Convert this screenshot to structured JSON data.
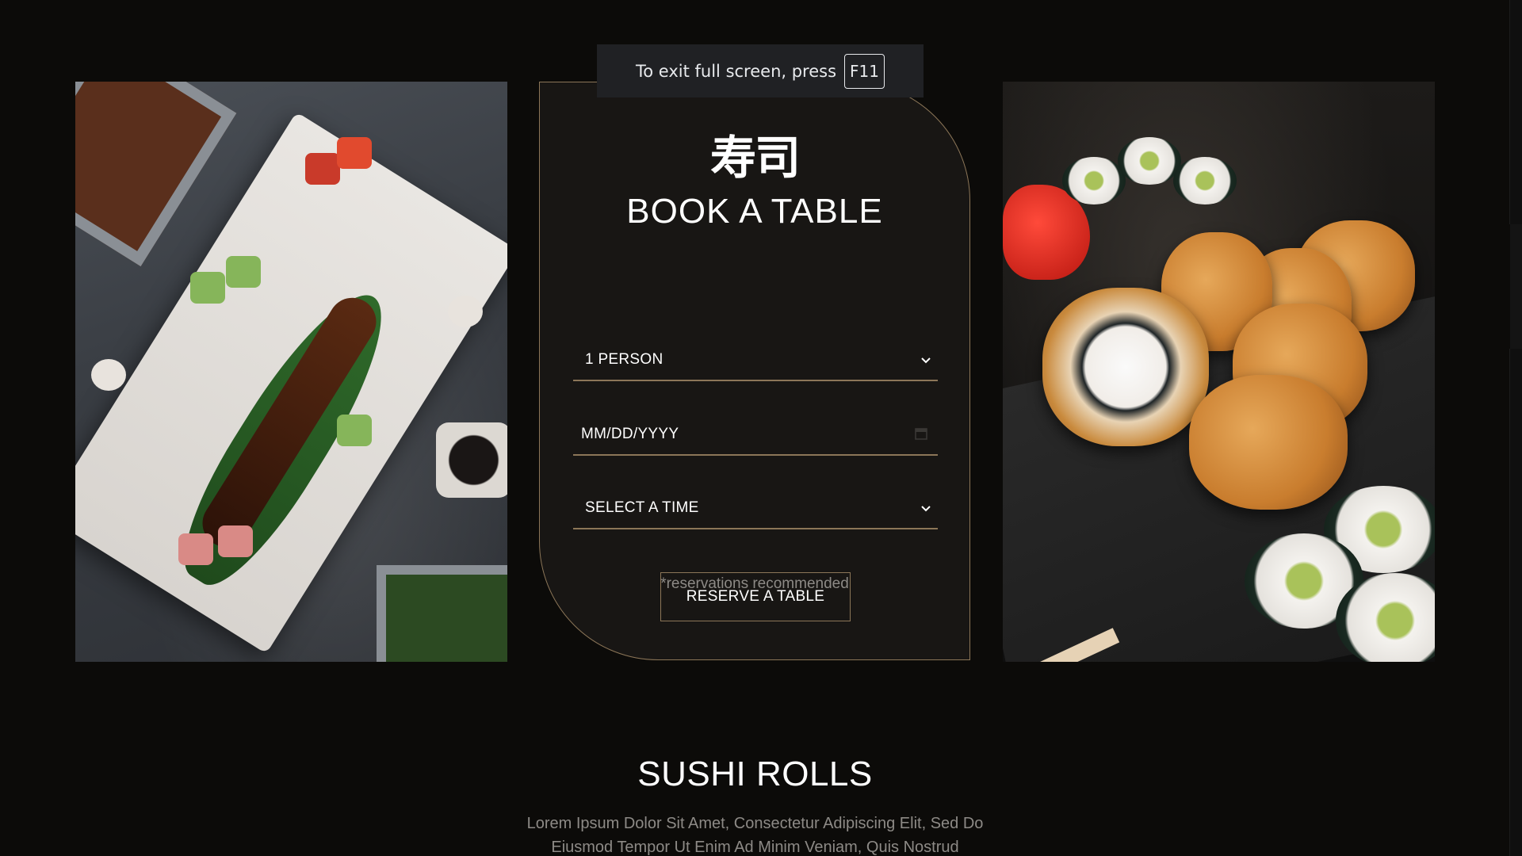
{
  "fullscreen_notice": {
    "text": "To exit full screen, press",
    "key": "F11"
  },
  "booking": {
    "kanji_logo": "寿司",
    "title": "BOOK A TABLE",
    "persons_select": {
      "selected": "1 PERSON",
      "icon": "chevron-down-icon"
    },
    "date_input": {
      "placeholder": "MM/DD/YYYY",
      "icon": "calendar-icon"
    },
    "time_select": {
      "selected": "SELECT A TIME",
      "icon": "chevron-down-icon"
    },
    "reserve_button": "RESERVE A TABLE",
    "note": "*reservations recommended"
  },
  "colors": {
    "page_background": "#0c0b09",
    "panel_background": "#181614",
    "accent_border": "#8c7658",
    "muted_text": "#8d8a86"
  },
  "section": {
    "title": "SUSHI ROLLS",
    "description": "Lorem Ipsum Dolor Sit Amet, Consectetur Adipiscing Elit, Sed Do Eiusmod Tempor Ut Enim Ad Minim Veniam, Quis Nostrud"
  }
}
